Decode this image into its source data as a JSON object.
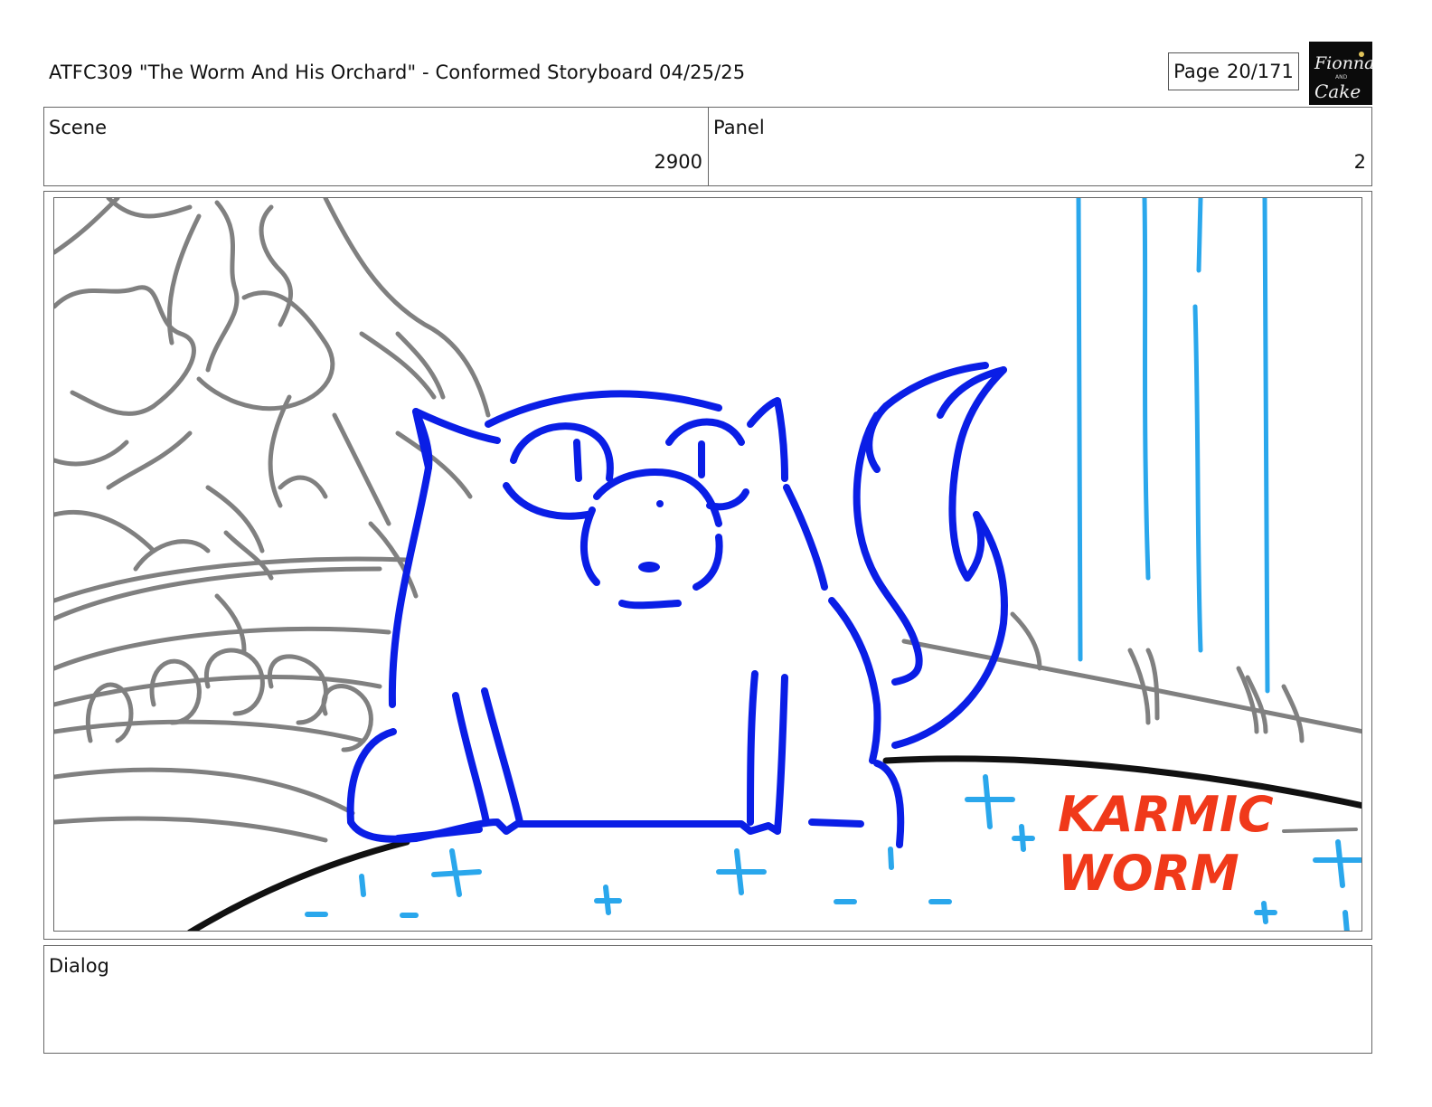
{
  "header": {
    "title": "ATFC309 \"The Worm And His Orchard\" - Conformed Storyboard 04/25/25",
    "page_label": "Page",
    "page_value": "20/171",
    "logo_text_top": "Fionna",
    "logo_text_and": "AND",
    "logo_text_bottom": "Cake"
  },
  "info": {
    "scene_label": "Scene",
    "scene_value": "2900",
    "panel_label": "Panel",
    "panel_value": "2"
  },
  "artwork": {
    "annotation_line1": "KARMIC",
    "annotation_line2": "WORM",
    "colors": {
      "character": "#0a1ee6",
      "effects": "#2aa7ec",
      "annotation": "#f0391a",
      "background": "#808080",
      "ground": "#111111"
    }
  },
  "dialog": {
    "label": "Dialog",
    "text": ""
  }
}
